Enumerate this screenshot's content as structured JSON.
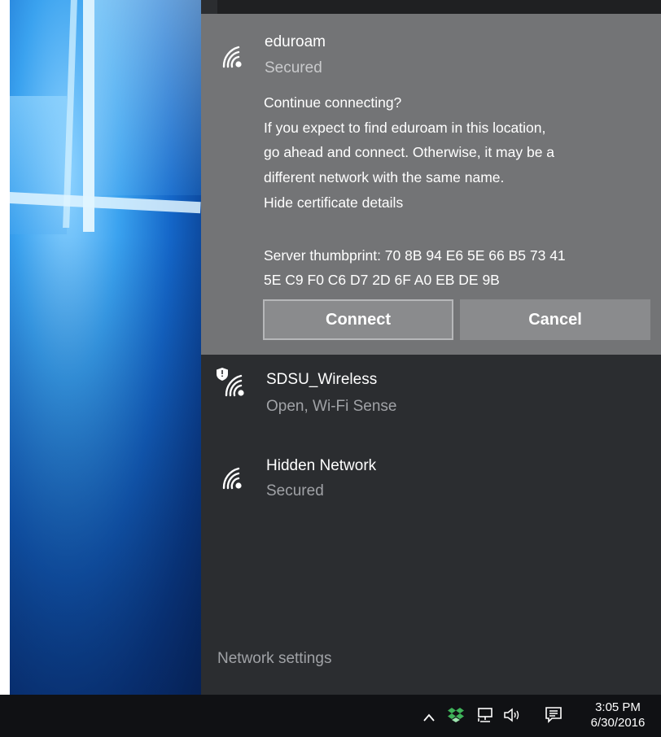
{
  "colors": {
    "flyout_background": "#2b2d30",
    "selected_background": "#737476",
    "button_background": "#8a8b8d",
    "taskbar_background": "#101114",
    "secondary_text": "#a0a2a6"
  },
  "flyout": {
    "selected_network": {
      "icon": "wifi-secured-icon",
      "name": "eduroam",
      "status": "Secured",
      "prompt": {
        "question": "Continue connecting?",
        "message_lines": [
          "If you expect to find eduroam in this location,",
          "go ahead and connect. Otherwise, it may be a",
          "different network with the same name."
        ],
        "toggle_link": "Hide certificate details",
        "thumbprint_lines": [
          "Server thumbprint: 70 8B 94 E6 5E 66 B5 73 41",
          "5E C9 F0 C6 D7 2D 6F A0 EB DE 9B"
        ]
      },
      "connect_label": "Connect",
      "cancel_label": "Cancel"
    },
    "networks": [
      {
        "icon": "wifi-open-shield-icon",
        "name": "SDSU_Wireless",
        "status": "Open, Wi-Fi Sense"
      },
      {
        "icon": "wifi-secured-icon",
        "name": "Hidden Network",
        "status": "Secured"
      }
    ],
    "network_settings_label": "Network settings"
  },
  "taskbar": {
    "tray_icons": [
      "chevron-up-icon",
      "dropbox-icon",
      "network-icon",
      "volume-icon",
      "action-center-icon"
    ],
    "show_hidden_glyph": "^",
    "time": "3:05 PM",
    "date": "6/30/2016"
  }
}
